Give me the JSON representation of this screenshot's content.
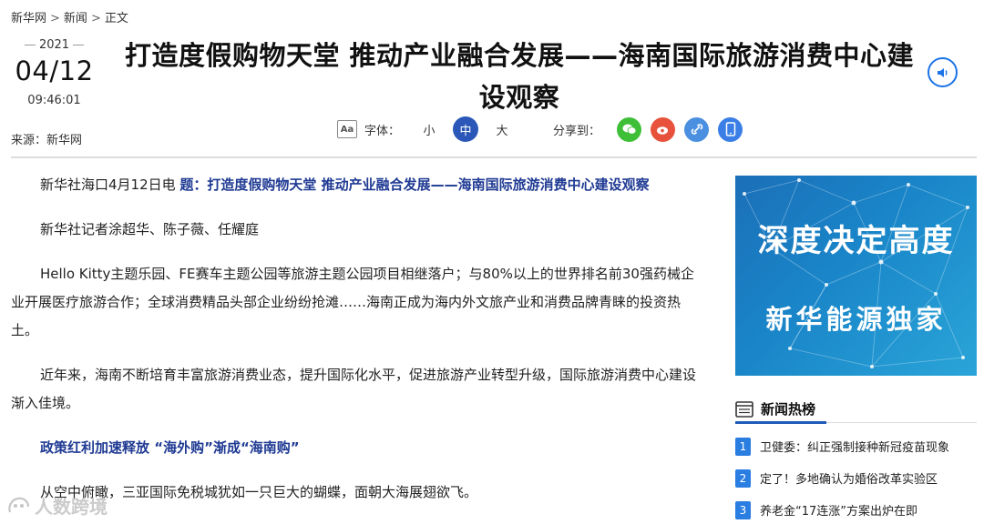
{
  "breadcrumb": [
    "新华网",
    "新闻",
    "正文"
  ],
  "breadcrumb_sep": ">",
  "date": {
    "year": "2021",
    "month_day": "04/12",
    "time": "09:46:01"
  },
  "source": "来源：新华网",
  "headline": "打造度假购物天堂 推动产业融合发展——海南国际旅游消费中心建设观察",
  "toolbar": {
    "font_label": "字体：",
    "font_sizes": [
      "小",
      "中",
      "大"
    ],
    "share_label": "分享到："
  },
  "article": {
    "lead_prefix": "新华社海口4月12日电",
    "lead_title": "题：打造度假购物天堂 推动产业融合发展——海南国际旅游消费中心建设观察",
    "reporters": "新华社记者涂超华、陈子薇、任耀庭",
    "p1": "Hello Kitty主题乐园、FE赛车主题公园等旅游主题公园项目相继落户；与80%以上的世界排名前30强药械企业开展医疗旅游合作；全球消费精品头部企业纷纷抢滩……海南正成为海内外文旅产业和消费品牌青睐的投资热土。",
    "p2": "近年来，海南不断培育丰富旅游消费业态，提升国际化水平，促进旅游产业转型升级，国际旅游消费中心建设渐入佳境。",
    "subhead": "政策红利加速释放 “海外购”渐成“海南购”",
    "p3": "从空中俯瞰，三亚国际免税城犹如一只巨大的蝴蝶，面朝大海展翅欲飞。"
  },
  "banner": {
    "line1": "深度决定高度",
    "line2": "新华能源独家"
  },
  "hot_news": {
    "title": "新闻热榜",
    "items": [
      {
        "num": "1",
        "text": "卫健委：纠正强制接种新冠疫苗现象"
      },
      {
        "num": "2",
        "text": "定了！多地确认为婚俗改革实验区"
      },
      {
        "num": "3",
        "text": "养老金“17连涨”方案出炉在即"
      }
    ]
  },
  "watermark": "人数跨境",
  "colors": {
    "accent": "#1f3a93",
    "active_font": "#2b58b8",
    "hot_num": "#2a7de1"
  }
}
